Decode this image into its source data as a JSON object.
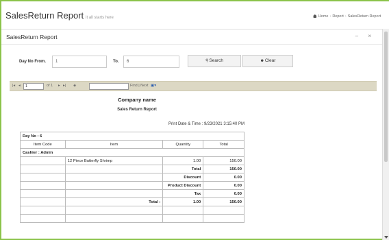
{
  "header": {
    "title": "SalesReturn Report",
    "subtitle": "it all starts here",
    "breadcrumb": [
      "Home",
      "Report",
      "SalesReturn Report"
    ]
  },
  "portlet": {
    "title": "SalesReturn Report",
    "tools": "– ×"
  },
  "filters": {
    "from_label": "Day No From.",
    "from_value": "1",
    "to_label": "To.",
    "to_value": "6",
    "search_label": "Search",
    "clear_label": "Clear"
  },
  "viewer": {
    "page_current": "1",
    "page_total": "of 1",
    "find_next": "Find | Next",
    "find_value": ""
  },
  "report": {
    "company": "Company name",
    "title": "Sales Return Report",
    "print_date": "Print Date & Time : 9/23/2021 3:15:40 PM",
    "day_no": "Day No : 6",
    "columns": [
      "Item Code",
      "Item",
      "Quantity",
      "Total"
    ],
    "cashier": "Cashier : Admin",
    "item_row": {
      "code": "",
      "item": "12 Piece Butterfly Shrimp",
      "qty": "1.00",
      "total": "150.00"
    },
    "summary": [
      {
        "label": "Total",
        "value": "150.00"
      },
      {
        "label": "Discount",
        "value": "0.00"
      },
      {
        "label": "Product Discount",
        "value": "0.00"
      },
      {
        "label": "Tax",
        "value": "0.00"
      }
    ],
    "grand": {
      "label": "Total :",
      "qty": "1.00",
      "total": "150.00"
    }
  },
  "colors": {
    "accent_border": "#8bc34a",
    "toolbar_bg": "#dcd8c4"
  }
}
